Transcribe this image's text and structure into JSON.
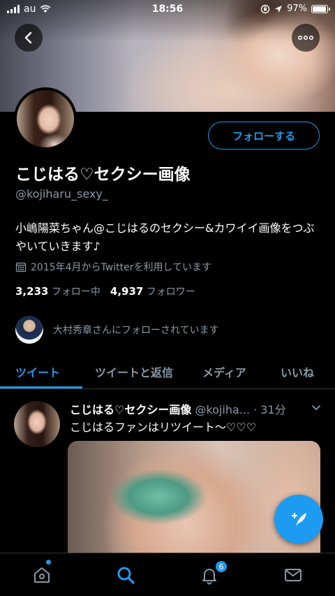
{
  "status_bar": {
    "carrier": "au",
    "time": "18:56",
    "battery": "97%",
    "battery_level": 0.97
  },
  "profile": {
    "follow_label": "フォローする",
    "name": "こじはる♡セクシー画像",
    "handle": "@kojiharu_sexy_",
    "bio": "小嶋陽菜ちゃん@こじはるのセクシー&カワイイ画像をつぶやいていきます♪",
    "joined": "2015年4月からTwitterを利用しています",
    "following_count": "3,233",
    "following_label": "フォロー中",
    "followers_count": "4,937",
    "followers_label": "フォロワー",
    "followed_by": "大村秀章さんにフォローされています"
  },
  "tabs": [
    {
      "label": "ツイート",
      "active": true
    },
    {
      "label": "ツイートと返信",
      "active": false
    },
    {
      "label": "メディア",
      "active": false
    },
    {
      "label": "いいね",
      "active": false
    }
  ],
  "tweet": {
    "name": "こじはる♡セクシー画像",
    "handle": "@kojiha...",
    "time": "· 31分",
    "text": "こじはるファンはリツイート〜♡♡♡"
  },
  "bottom_nav": {
    "items": [
      "home-icon",
      "search-icon",
      "notifications-icon",
      "messages-icon"
    ],
    "notification_badge": "6"
  },
  "colors": {
    "accent": "#1d9bf0",
    "muted": "#8899a6",
    "background": "#000000"
  }
}
